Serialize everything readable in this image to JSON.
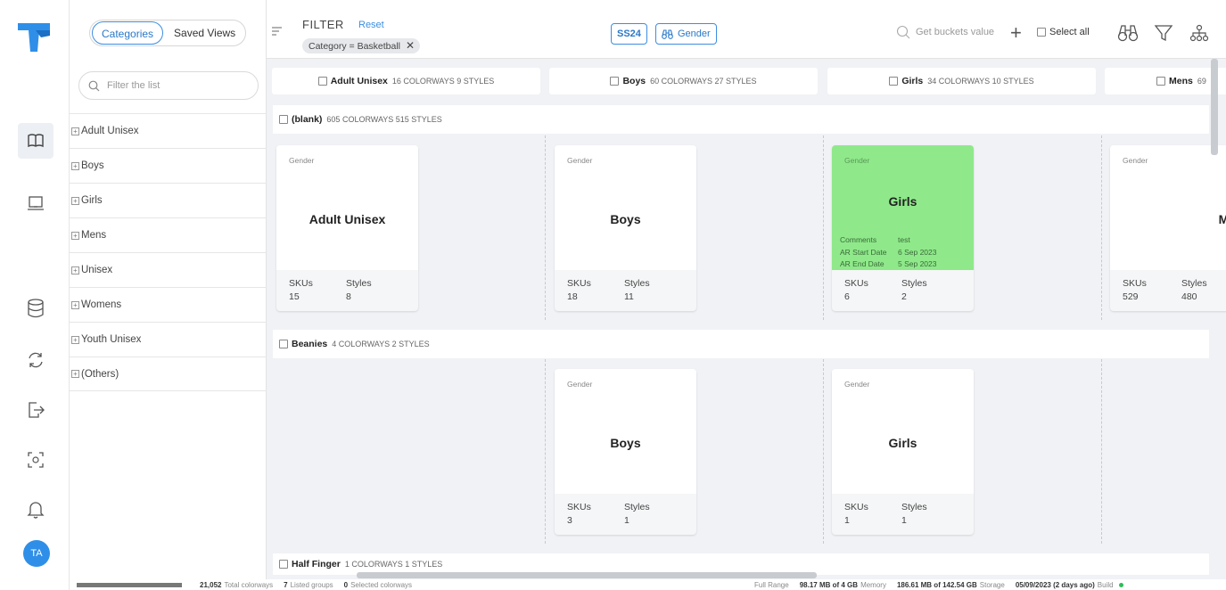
{
  "rail": {
    "avatar_initials": "TA",
    "brand_color": "#2f8fe8",
    "icons": [
      "book-icon",
      "laptop-icon",
      "database-icon",
      "sync-icon",
      "export-icon",
      "scan-icon",
      "bell-icon"
    ]
  },
  "catpanel": {
    "tabs": [
      "Categories",
      "Saved Views"
    ],
    "filter_placeholder": "Filter the list",
    "items": [
      "Adult Unisex",
      "Boys",
      "Girls",
      "Mens",
      "Unisex",
      "Womens",
      "Youth Unisex",
      "(Others)"
    ]
  },
  "topbar": {
    "filter_title": "FILTER",
    "reset": "Reset",
    "chip": "Category = Basketball",
    "season_pill": "SS24",
    "gender_pill": "Gender",
    "get_buckets": "Get buckets value",
    "select_all": "Select all"
  },
  "columns": [
    {
      "name": "Adult Unisex",
      "meta": "16 COLORWAYS  9 STYLES"
    },
    {
      "name": "Boys",
      "meta": "60 COLORWAYS  27 STYLES"
    },
    {
      "name": "Girls",
      "meta": "34 COLORWAYS  10 STYLES"
    },
    {
      "name": "Mens",
      "meta": "69"
    }
  ],
  "groups": [
    {
      "name": "(blank)",
      "meta": "605 COLORWAYS  515 STYLES"
    },
    {
      "name": "Beanies",
      "meta": "4 COLORWAYS  2 STYLES"
    },
    {
      "name": "Half Finger",
      "meta": "1 COLORWAYS  1 STYLES"
    }
  ],
  "cards": {
    "label": "Gender",
    "skus_label": "SKUs",
    "styles_label": "Styles",
    "blank": [
      {
        "name": "Adult Unisex",
        "skus": "15",
        "styles": "8"
      },
      {
        "name": "Boys",
        "skus": "18",
        "styles": "11"
      },
      {
        "name": "Girls",
        "skus": "6",
        "styles": "2",
        "comments_label": "Comments",
        "comments": "test",
        "ar_start_label": "AR Start Date",
        "ar_start": "6 Sep 2023",
        "ar_end_label": "AR End Date",
        "ar_end": "5 Sep 2023",
        "highlight": "#8fe98a"
      },
      {
        "name": "Mens",
        "skus": "529",
        "styles": "480"
      }
    ],
    "beanies": [
      {
        "name": "Boys",
        "skus": "3",
        "styles": "1"
      },
      {
        "name": "Girls",
        "skus": "1",
        "styles": "1"
      }
    ]
  },
  "status": {
    "total_colorways_value": "21,052",
    "total_colorways_label": "Total colorways",
    "listed_groups_value": "7",
    "listed_groups_label": "Listed groups",
    "selected_value": "0",
    "selected_label": "Selected colorways",
    "full_range": "Full Range",
    "memory_value": "98.17 MB of 4 GB",
    "memory_label": "Memory",
    "storage_value": "186.61 MB of 142.54 GB",
    "storage_label": "Storage",
    "build_value": "05/09/2023 (2 days ago)",
    "build_label": "Build"
  }
}
